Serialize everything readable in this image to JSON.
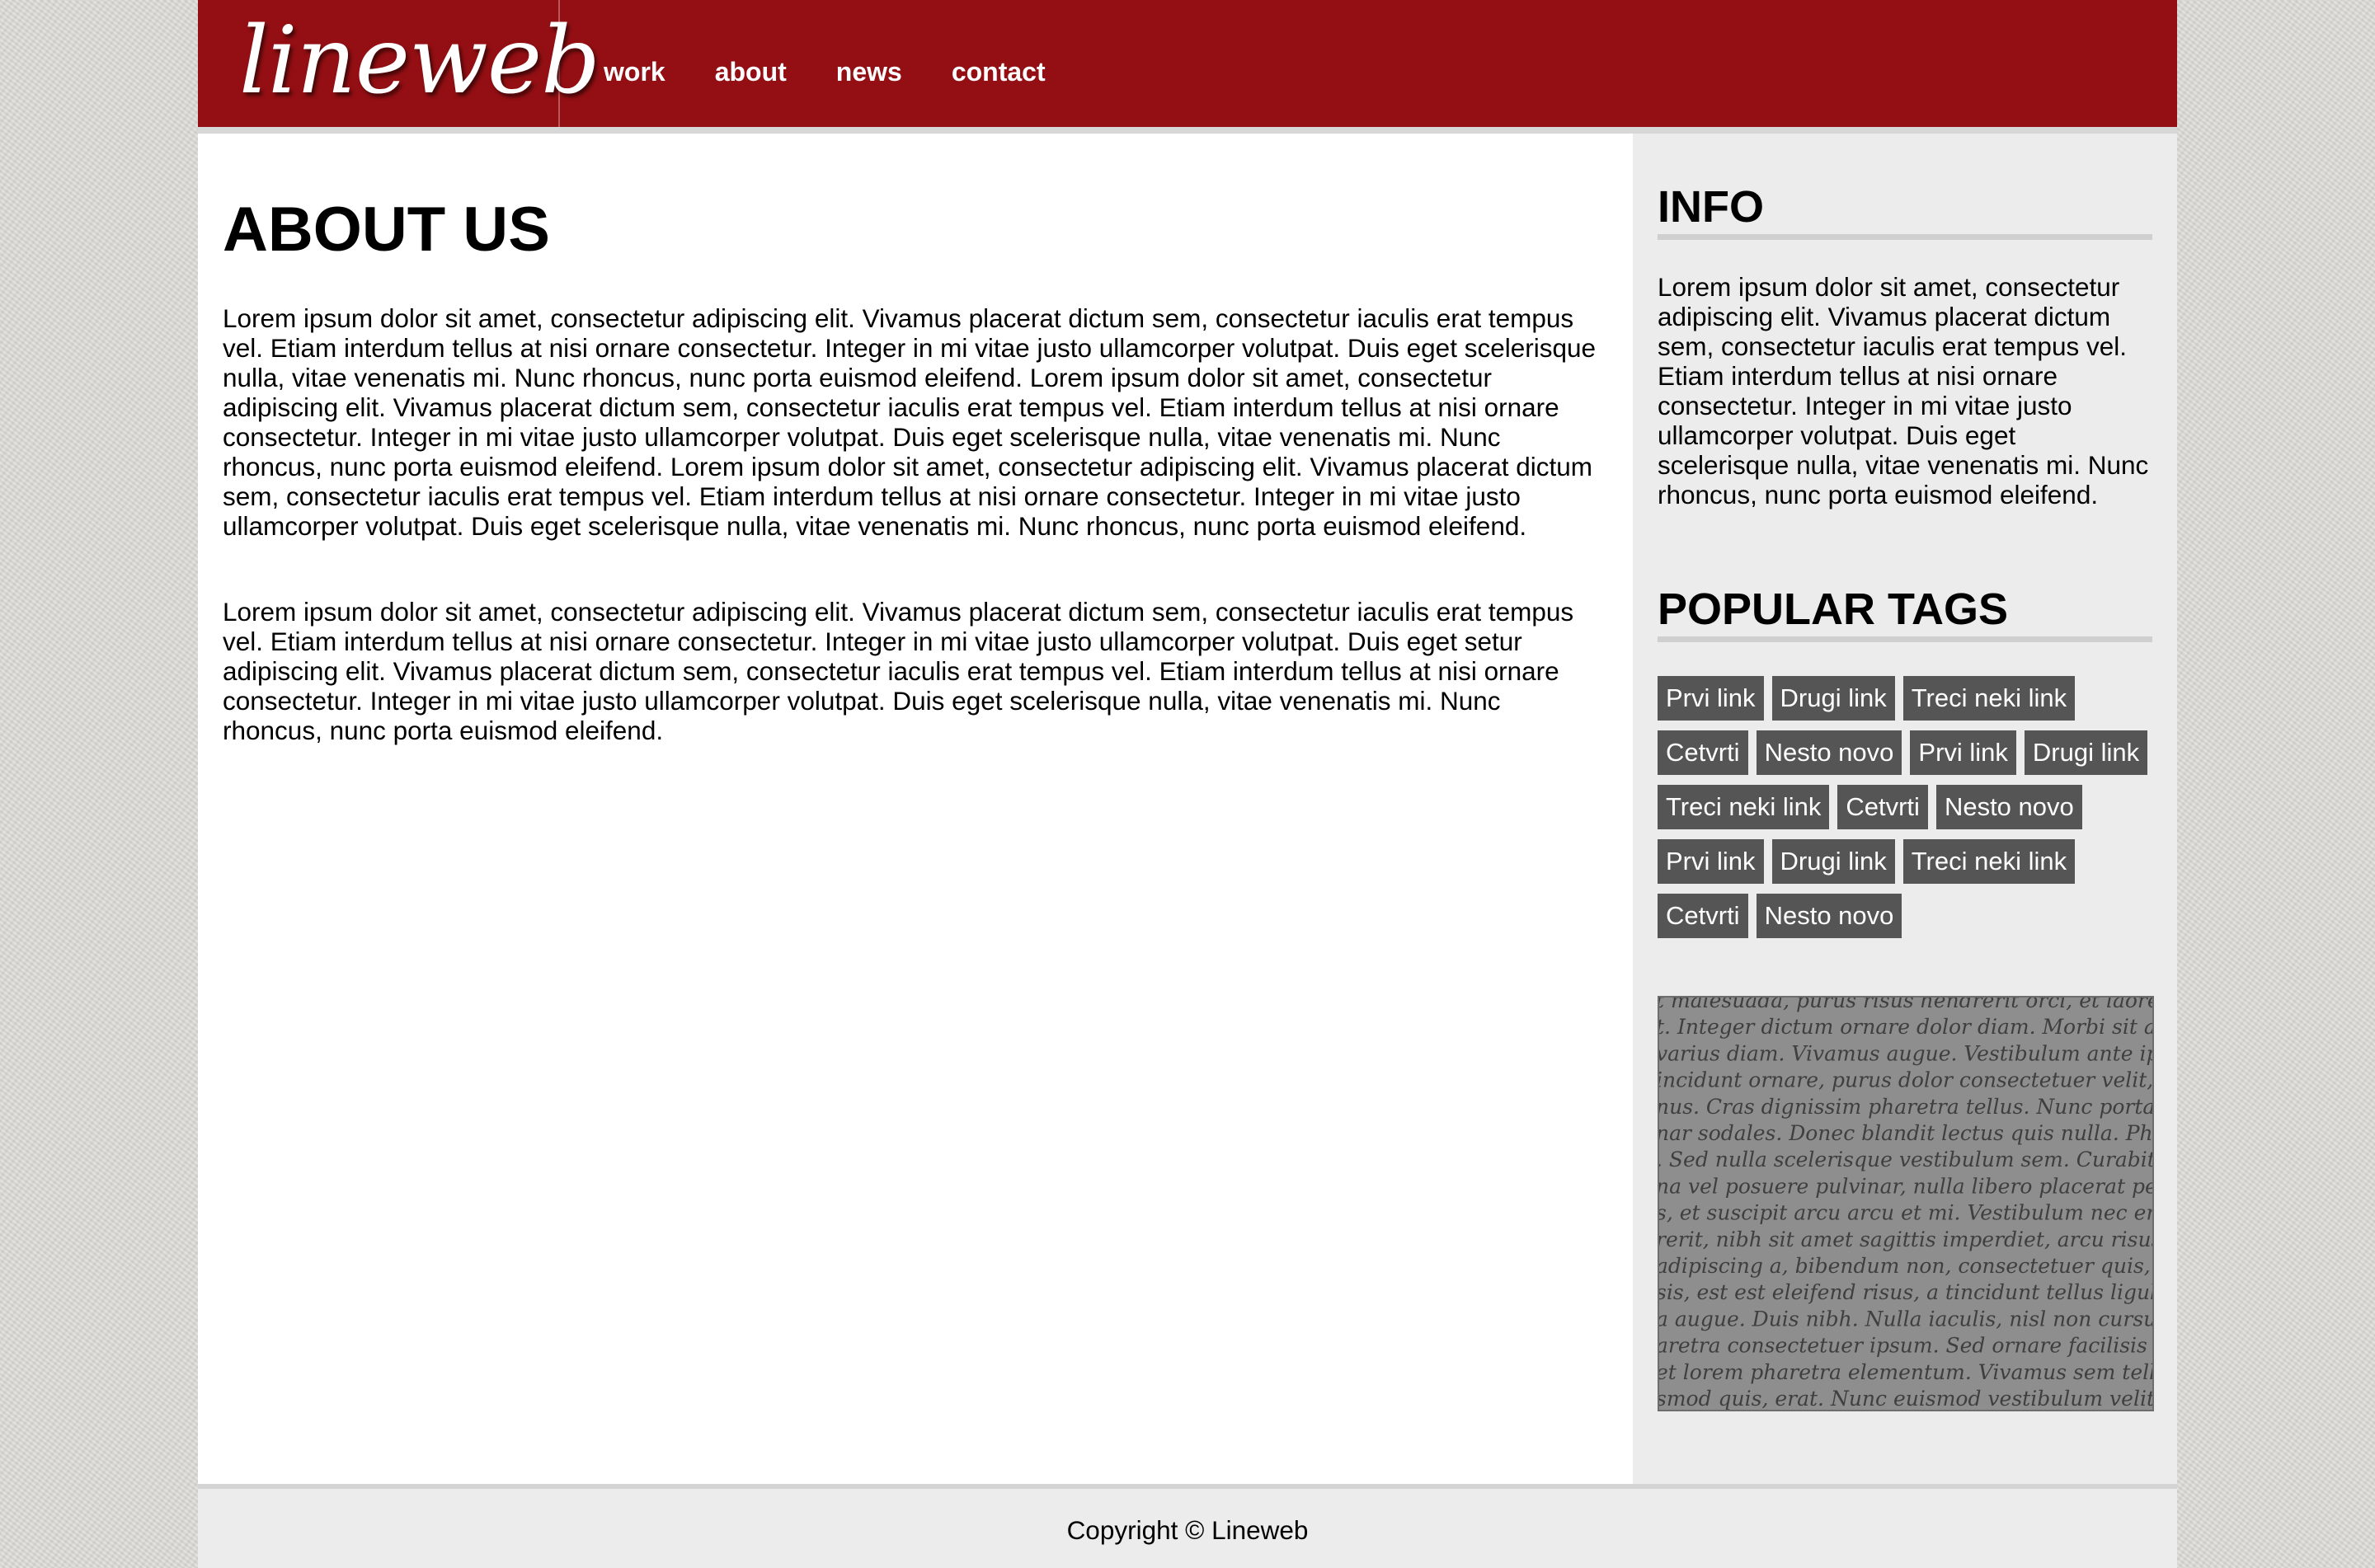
{
  "header": {
    "logo_text": "lineweb",
    "nav": [
      {
        "label": "work"
      },
      {
        "label": "about"
      },
      {
        "label": "news"
      },
      {
        "label": "contact"
      }
    ],
    "brand_color": "#930f13"
  },
  "main": {
    "title": "ABOUT US",
    "paragraphs": [
      "Lorem ipsum dolor sit amet, consectetur adipiscing elit. Vivamus placerat dictum sem, consectetur iaculis erat tempus vel. Etiam interdum tellus at nisi ornare consectetur. Integer in mi vitae justo ullamcorper volutpat. Duis eget scelerisque nulla, vitae venenatis mi. Nunc rhoncus, nunc porta euismod eleifend. Lorem ipsum dolor sit amet, consectetur adipiscing elit. Vivamus placerat dictum sem, consectetur iaculis erat tempus vel. Etiam interdum tellus at nisi ornare consectetur. Integer in mi vitae justo ullamcorper volutpat. Duis eget scelerisque nulla, vitae venenatis mi. Nunc rhoncus, nunc porta euismod eleifend. Lorem ipsum dolor sit amet, consectetur adipiscing elit. Vivamus placerat dictum sem, consectetur iaculis erat tempus vel. Etiam interdum tellus at nisi ornare consectetur. Integer in mi vitae justo ullamcorper volutpat. Duis eget scelerisque nulla, vitae venenatis mi. Nunc rhoncus, nunc porta euismod eleifend.",
      "Lorem ipsum dolor sit amet, consectetur adipiscing elit. Vivamus placerat dictum sem, consectetur iaculis erat tempus vel. Etiam interdum tellus at nisi ornare consectetur. Integer in mi vitae justo ullamcorper volutpat. Duis eget setur adipiscing elit. Vivamus placerat dictum sem, consectetur iaculis erat tempus vel. Etiam interdum tellus at nisi ornare consectetur. Integer in mi vitae justo ullamcorper volutpat. Duis eget scelerisque nulla, vitae venenatis mi. Nunc rhoncus, nunc porta euismod eleifend."
    ]
  },
  "sidebar": {
    "info_heading": "INFO",
    "info_text": "Lorem ipsum dolor sit amet, consectetur adipiscing elit. Vivamus placerat dictum sem, consectetur iaculis erat tempus vel. Etiam interdum tellus at nisi ornare consectetur. Integer in mi vitae justo ullamcorper volutpat. Duis eget scelerisque nulla, vitae venenatis mi. Nunc rhoncus, nunc porta euismod eleifend.",
    "tags_heading": "POPULAR TAGS",
    "tags": [
      "Prvi link",
      "Drugi link",
      "Treci neki link",
      "Cetvrti",
      "Nesto novo",
      "Prvi link",
      "Drugi link",
      "Treci neki link",
      "Cetvrti",
      "Nesto novo",
      "Prvi link",
      "Drugi link",
      "Treci neki link",
      "Cetvrti",
      "Nesto novo"
    ],
    "tag_color": "#555555",
    "manuscript_lines": [
      "t malesuada, purus risus hendrerit orci, et laoreet pede en",
      "t. Integer dictum ornare dolor diam. Morbi sit amet arcu n",
      "varius diam. Vivamus augue. Vestibulum ante ipsum pede",
      "incidunt ornare, purus dolor consectetuer velit, in euismod",
      "nus. Cras dignissim pharetra tellus. Nunc porta commodo",
      "nar sodales. Donec blandit lectus quis nulla. Phasellus dui",
      ". Sed nulla scelerisque vestibulum sem. Curabitur libero m",
      "na vel posuere pulvinar, nulla libero placerat pede, at con",
      "s, et suscipit arcu arcu et mi. Vestibulum nec eros dictum",
      "rerit, nibh sit amet sagittis imperdiet, arcu risus suscipit a",
      "adipiscing a, bibendum non, consectetuer quis, sem. Proin",
      "sis, est est eleifend risus, a tincidunt tellus ligula et lectus.",
      "a augue. Duis nibh. Nulla iaculis, nisl non cursus iaculis, p",
      "aretra consectetuer ipsum. Sed ornare facilisis odio. Cum s",
      "et lorem pharetra elementum. Vivamus sem tellus, digniss",
      "smod quis, erat. Nunc euismod vestibulum velit. Proin ur"
    ]
  },
  "footer": {
    "copyright": "Copyright © Lineweb"
  }
}
